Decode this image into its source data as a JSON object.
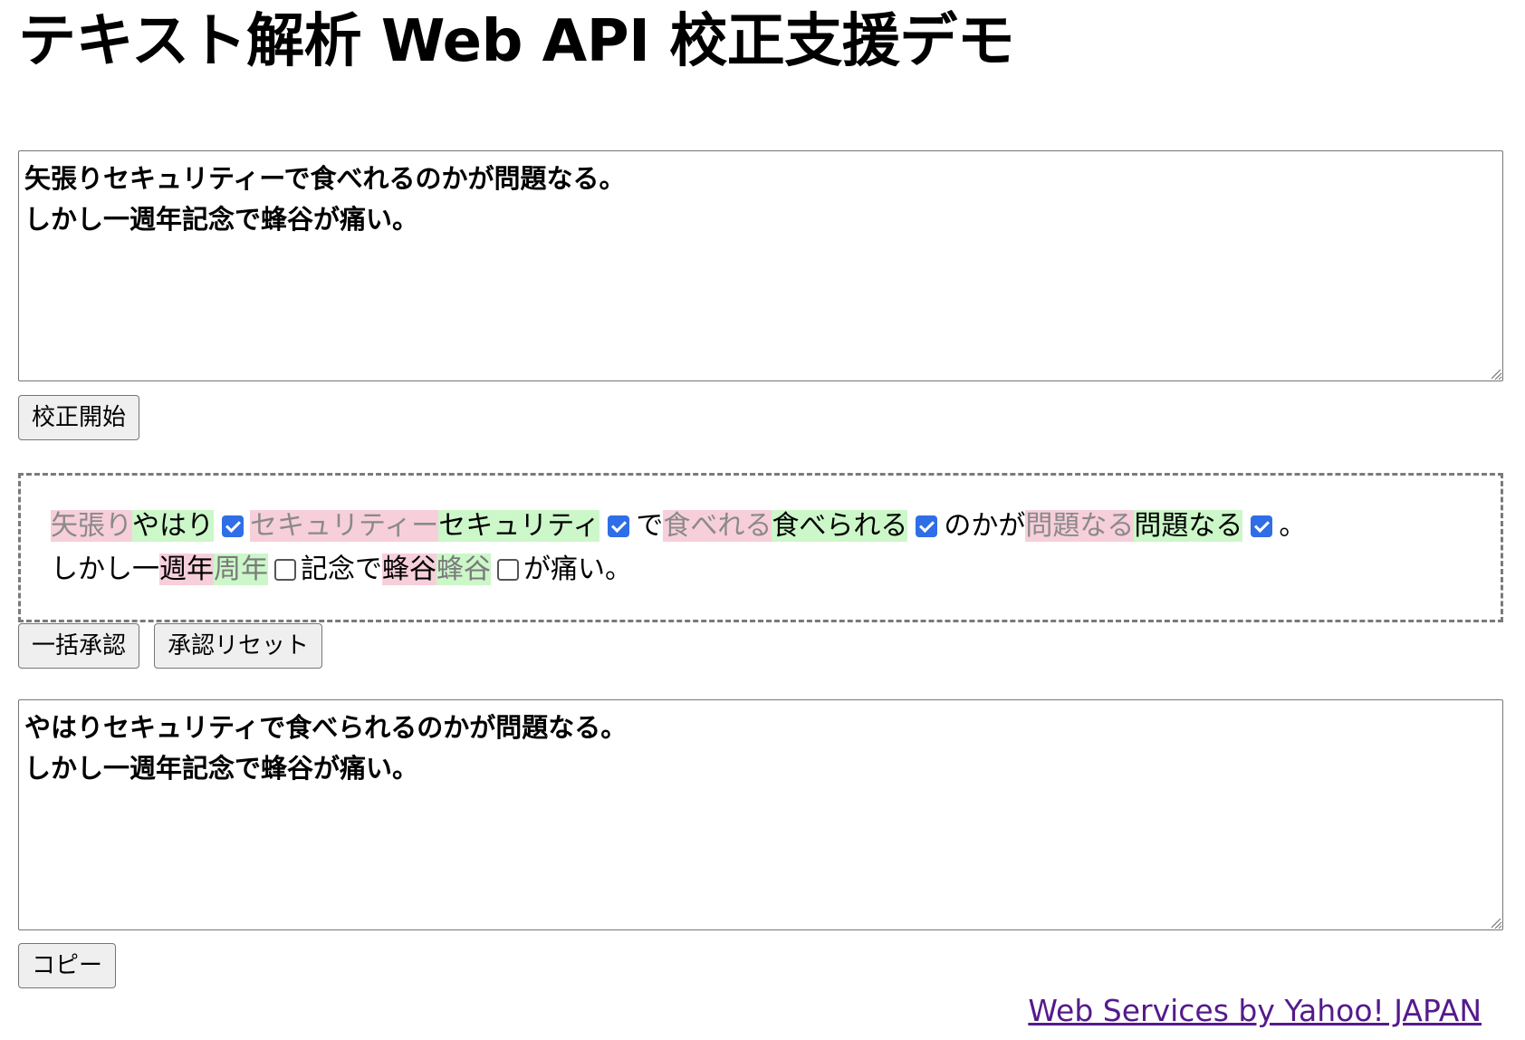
{
  "page_title": "テキスト解析 Web API 校正支援デモ",
  "input": {
    "value": "矢張りセキュリティーで食べれるのかが問題なる。\nしかし一週年記念で蜂谷が痛い。"
  },
  "buttons": {
    "start": "校正開始",
    "approve_all": "一括承認",
    "reset_approval": "承認リセット",
    "copy": "コピー"
  },
  "result": {
    "line1": {
      "s1_del": "矢張り",
      "s1_ins": "やはり",
      "s2_del": "セキュリティー",
      "s2_ins": "セキュリティ",
      "t1": "で",
      "s3_del": "食べれる",
      "s3_ins": "食べられる",
      "t2": "のかが",
      "s4_del": "問題なる",
      "s4_ins": "問題なる",
      "t3": "。"
    },
    "line2": {
      "t1": "しかし一",
      "s1_del": "週年",
      "s1_ins": "周年",
      "t2": "記念で",
      "s2_del": "蜂谷",
      "s2_ins": "蜂谷",
      "t3": "が痛い。"
    }
  },
  "output": {
    "value": "やはりセキュリティで食べられるのかが問題なる。\nしかし一週年記念で蜂谷が痛い。"
  },
  "footer": {
    "link": "Web Services by Yahoo! JAPAN"
  },
  "colors": {
    "deleted_bg": "#f7cfdb",
    "inserted_bg": "#ccf7c9",
    "checkbox_on": "#2f6ee6",
    "link": "#551a8b"
  }
}
